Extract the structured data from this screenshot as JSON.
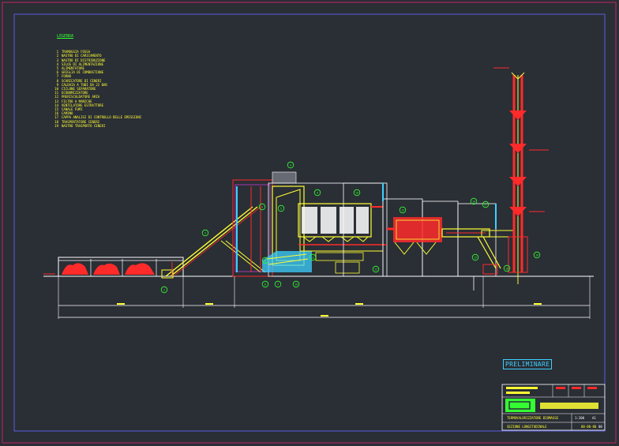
{
  "legend": {
    "title": "LEGENDA",
    "items": [
      {
        "n": "1",
        "t": "TRAMOGGIA FOSSA"
      },
      {
        "n": "2",
        "t": "NASTRO DI CARICAMENTO"
      },
      {
        "n": "3",
        "t": "NASTRO DI DISTRIBUZIONE"
      },
      {
        "n": "4",
        "t": "SILOS DI ALIMENTAZIONE"
      },
      {
        "n": "5",
        "t": "ALIMENTATORE"
      },
      {
        "n": "6",
        "t": "GRIGLIA DI COMBUSTIONE"
      },
      {
        "n": "7",
        "t": "FORNO"
      },
      {
        "n": "8",
        "t": "SCARICATORE DI CENERI"
      },
      {
        "n": "9",
        "t": "CALDAIA A TUBI DA 22 BAR"
      },
      {
        "n": "10",
        "t": "CICLONE SEPARATORE"
      },
      {
        "n": "11",
        "t": "ECONOMIZZATORE"
      },
      {
        "n": "12",
        "t": "PRERISCALDATORE ARIA"
      },
      {
        "n": "13",
        "t": "FILTRO A MANICHE"
      },
      {
        "n": "14",
        "t": "VENTILATORE ESTRATTORE"
      },
      {
        "n": "15",
        "t": "CANALE FUMI"
      },
      {
        "n": "16",
        "t": "CAMINO"
      },
      {
        "n": "17",
        "t": "CAPPA ANALISI DI CONTROLLO DELLE EMISSIONI"
      },
      {
        "n": "18",
        "t": "TRASPORTATORE CENERI"
      },
      {
        "n": "19",
        "t": "NASTRO TRASPORTO CENERI"
      }
    ]
  },
  "callouts": [
    "1",
    "2",
    "3",
    "4",
    "5",
    "6",
    "7",
    "8",
    "9",
    "10",
    "11",
    "12",
    "13",
    "14",
    "15",
    "16",
    "17",
    "18",
    "19"
  ],
  "stamp": "PRELIMINARE",
  "title_block": {
    "project": "TERMOVALORIZZATORE BIOMASSE",
    "drawing": "SEZIONE LONGITUDINALE",
    "scale": "1:200",
    "sheet": "A1",
    "date": "00-00-00",
    "rev": "00"
  },
  "colors": {
    "background": "#2a2e35",
    "border": "#c0246a",
    "structure": "#ffff33",
    "equipment": "#ff2a2a",
    "cyan": "#3dd0ff",
    "magenta": "#ff40ff",
    "green": "#33ff33",
    "white": "#ffffff"
  }
}
